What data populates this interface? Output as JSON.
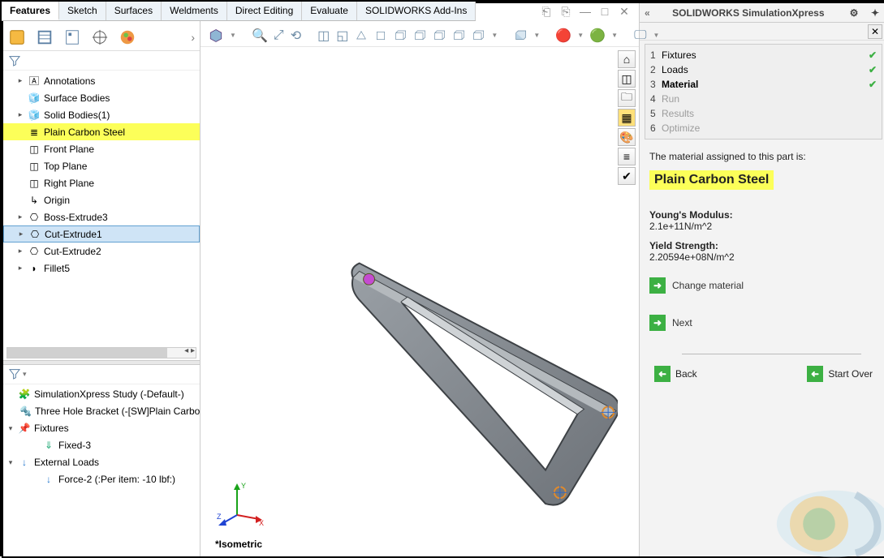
{
  "tabs": {
    "items": [
      "Features",
      "Sketch",
      "Surfaces",
      "Weldments",
      "Direct Editing",
      "Evaluate",
      "SOLIDWORKS Add-Ins"
    ],
    "active": 0
  },
  "tree": {
    "items": [
      {
        "label": "Annotations",
        "expandable": true
      },
      {
        "label": "Surface Bodies",
        "expandable": false
      },
      {
        "label": "Solid Bodies(1)",
        "expandable": true
      },
      {
        "label": "Plain Carbon Steel",
        "expandable": false,
        "highlight": true
      },
      {
        "label": "Front Plane",
        "expandable": false
      },
      {
        "label": "Top Plane",
        "expandable": false
      },
      {
        "label": "Right Plane",
        "expandable": false
      },
      {
        "label": "Origin",
        "expandable": false
      },
      {
        "label": "Boss-Extrude3",
        "expandable": true
      },
      {
        "label": "Cut-Extrude1",
        "expandable": true,
        "selected": true
      },
      {
        "label": "Cut-Extrude2",
        "expandable": true
      },
      {
        "label": "Fillet5",
        "expandable": true
      }
    ]
  },
  "study_tree": {
    "root": "SimulationXpress Study (-Default-)",
    "part": "Three Hole Bracket (-[SW]Plain Carbo",
    "fixtures": {
      "label": "Fixtures",
      "children": [
        "Fixed-3"
      ]
    },
    "loads": {
      "label": "External Loads",
      "children": [
        "Force-2 (:Per item: -10 lbf:)"
      ]
    }
  },
  "viewport": {
    "label": "*Isometric",
    "axes": {
      "x": "X",
      "y": "Y",
      "z": "Z"
    }
  },
  "sim_panel": {
    "title": "SOLIDWORKS SimulationXpress",
    "steps": [
      {
        "num": "1",
        "label": "Fixtures",
        "done": true
      },
      {
        "num": "2",
        "label": "Loads",
        "done": true
      },
      {
        "num": "3",
        "label": "Material",
        "done": true,
        "current": true
      },
      {
        "num": "4",
        "label": "Run",
        "disabled": true
      },
      {
        "num": "5",
        "label": "Results",
        "disabled": true
      },
      {
        "num": "6",
        "label": "Optimize",
        "disabled": true
      }
    ],
    "hint": "The material assigned to this part is:",
    "material": "Plain Carbon Steel",
    "young_label": "Young's Modulus:",
    "young_val": "2.1e+11N/m^2",
    "yield_label": "Yield Strength:",
    "yield_val": "2.20594e+08N/m^2",
    "change": "Change material",
    "next": "Next",
    "back": "Back",
    "start_over": "Start Over"
  }
}
